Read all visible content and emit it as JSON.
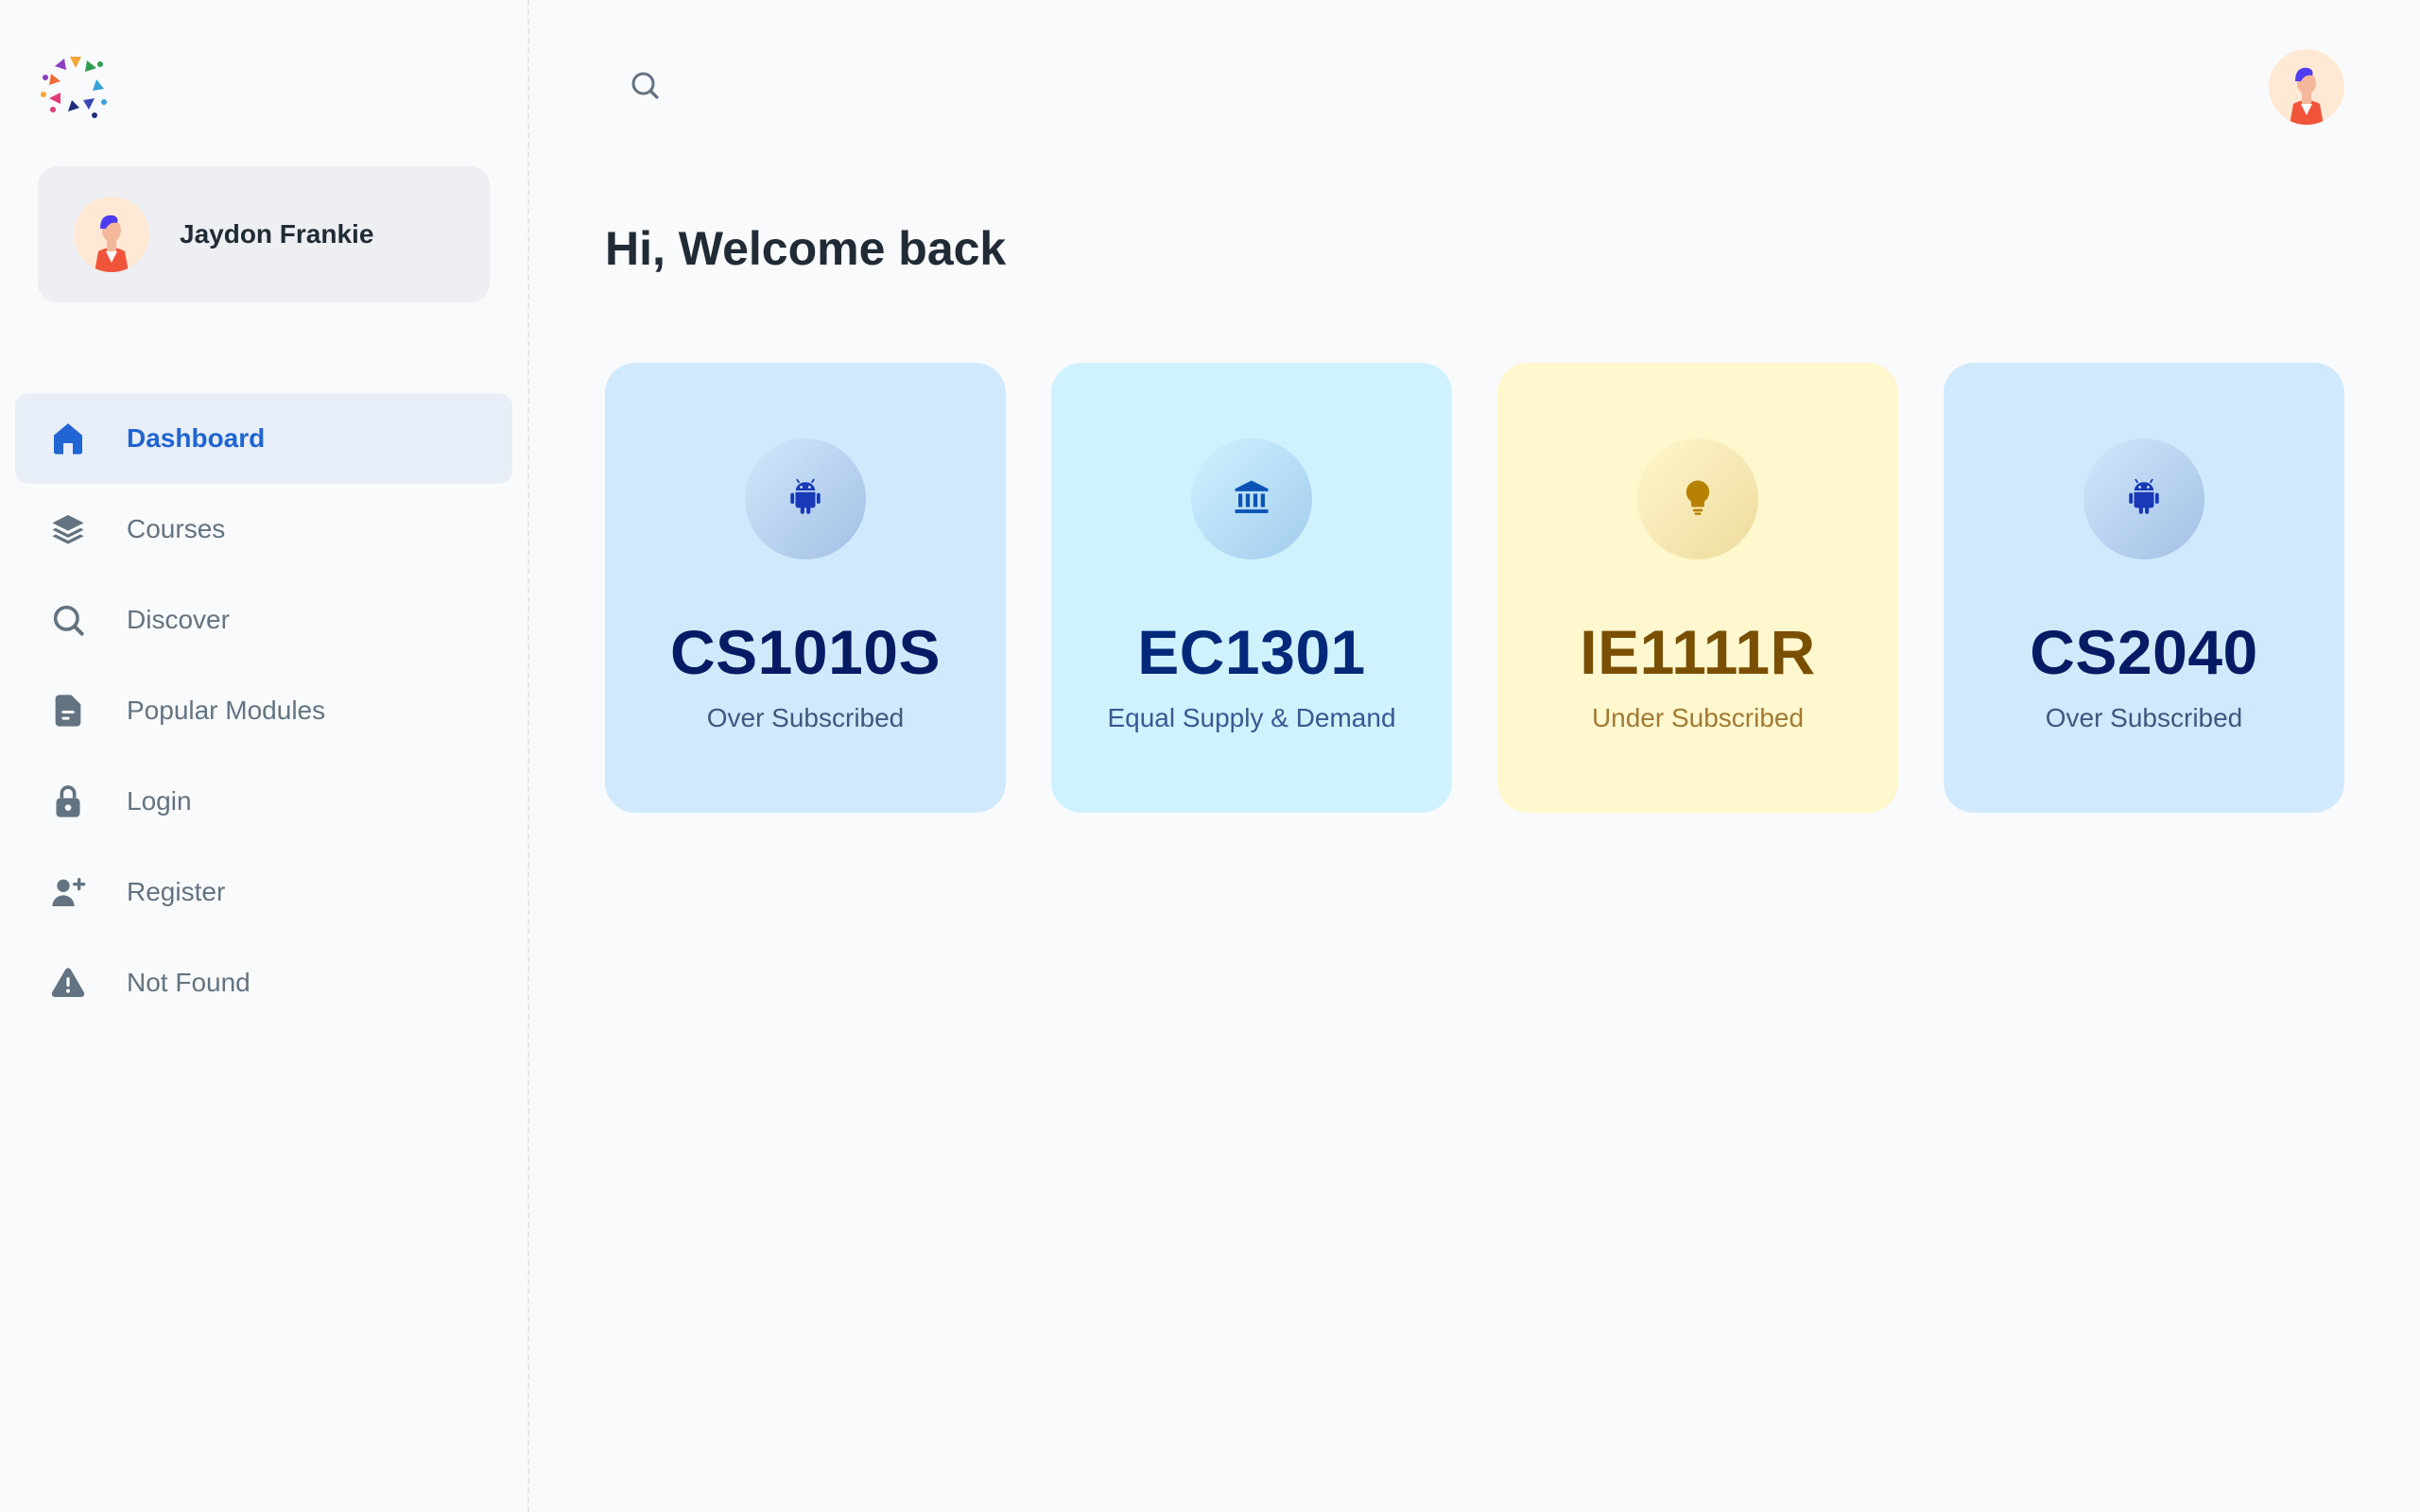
{
  "app": {
    "logo_icon": "minimal-logo"
  },
  "account": {
    "name": "Jaydon Frankie",
    "avatar_icon": "avatar-illustration"
  },
  "nav": {
    "items": [
      {
        "label": "Dashboard",
        "icon": "home-icon",
        "active": true
      },
      {
        "label": "Courses",
        "icon": "layers-icon",
        "active": false
      },
      {
        "label": "Discover",
        "icon": "search-icon",
        "active": false
      },
      {
        "label": "Popular Modules",
        "icon": "file-text-icon",
        "active": false
      },
      {
        "label": "Login",
        "icon": "lock-icon",
        "active": false
      },
      {
        "label": "Register",
        "icon": "person-add-icon",
        "active": false
      },
      {
        "label": "Not Found",
        "icon": "alert-triangle-icon",
        "active": false
      }
    ]
  },
  "header": {
    "search_icon": "search-icon",
    "avatar_icon": "avatar-illustration"
  },
  "main": {
    "greeting": "Hi, Welcome back",
    "cards": [
      {
        "code": "CS1010S",
        "status": "Over Subscribed",
        "icon": "android-icon",
        "color": "#d1e9fc"
      },
      {
        "code": "EC1301",
        "status": "Equal Supply & Demand",
        "icon": "bank-icon",
        "color": "#d0f2ff"
      },
      {
        "code": "IE1111R",
        "status": "Under Subscribed",
        "icon": "lightbulb-icon",
        "color": "#fff7cd"
      },
      {
        "code": "CS2040",
        "status": "Over Subscribed",
        "icon": "android-icon",
        "color": "#d1e9fc"
      }
    ]
  },
  "colors": {
    "primary": "#2065d1",
    "text_primary": "#212b36",
    "text_secondary": "#637381",
    "background": "#f9fafb"
  }
}
